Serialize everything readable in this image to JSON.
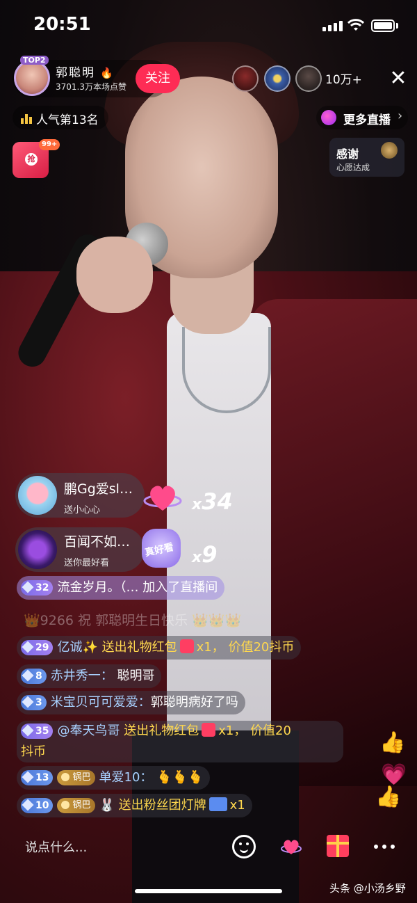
{
  "status_bar": {
    "time": "20:51"
  },
  "host": {
    "rank_badge": "TOP2",
    "name": "郭聪明",
    "fire": "🔥",
    "likes": "3701.3万本场点赞",
    "follow_label": "关注"
  },
  "viewers": {
    "count": "10万+"
  },
  "popularity": {
    "label": "人气第13名"
  },
  "more_live": {
    "label": "更多直播"
  },
  "red_envelope": {
    "badge": "99+",
    "seal": "抢"
  },
  "thanks_card": {
    "title": "感谢",
    "subtitle": "心愿达成"
  },
  "gift_combos": [
    {
      "name": "鹏Gg爱sl…",
      "action": "送小心心",
      "count": "34",
      "x_label": "x"
    },
    {
      "name": "百闻不如…",
      "action": "送你最好看",
      "gift_text": "真好看",
      "count": "9",
      "x_label": "x"
    }
  ],
  "chat": {
    "join": {
      "level": "32",
      "user": "流金岁月。（…",
      "text": "加入了直播间"
    },
    "ghost": "👑9266 祝 郭聪明生日快乐 👑👑👑",
    "messages": [
      {
        "level": "29",
        "user": "亿诚✨",
        "action": "送出礼物红包",
        "qty": "x1，",
        "value": "价值20抖币"
      },
      {
        "level": "8",
        "user": "赤井秀一：",
        "text": "聪明哥"
      },
      {
        "level": "3",
        "user": "米宝贝可可爱爱：",
        "text": "郭聪明病好了吗"
      },
      {
        "level": "35",
        "user": "@奉天鸟哥",
        "action": "送出礼物红包",
        "qty": "x1，",
        "value": "价值20",
        "value2": "抖币"
      },
      {
        "level": "13",
        "fan": "锅巴",
        "user": "单爱10：",
        "text": "🫰🫰🫰"
      },
      {
        "level": "10",
        "fan": "锅巴",
        "user": "🐰",
        "action": "送出粉丝团灯牌",
        "qty": "x1"
      }
    ]
  },
  "bottom_bar": {
    "input_placeholder": "说点什么..."
  },
  "watermark": "头条 @小汤乡野"
}
